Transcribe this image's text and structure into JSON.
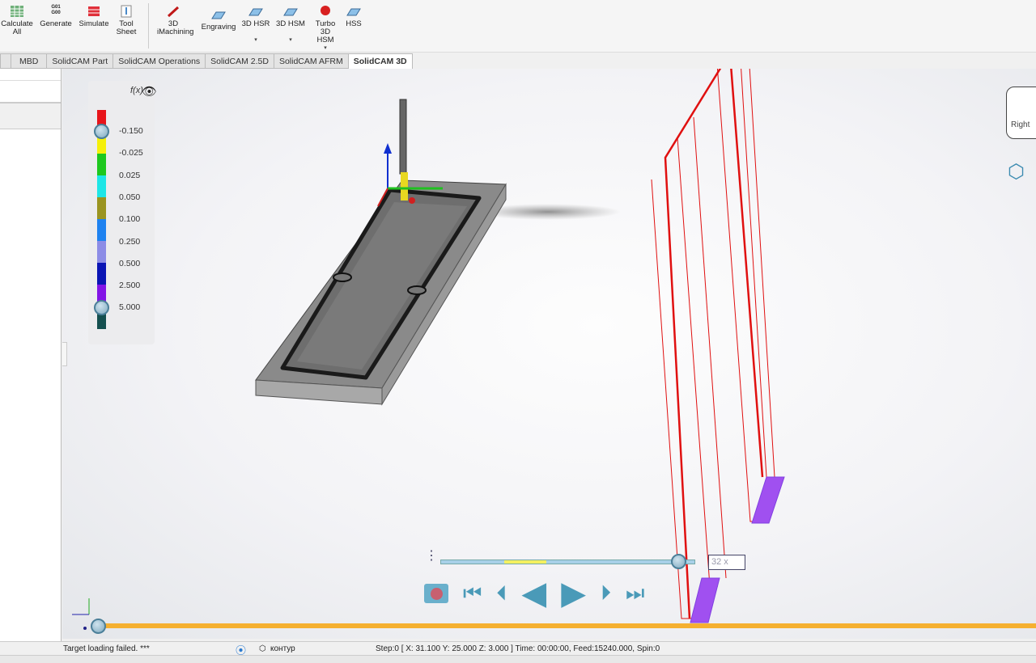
{
  "ribbon": {
    "buttons": [
      {
        "label": "Calculate All",
        "icon": "calculator-grid-icon"
      },
      {
        "label": "Generate",
        "icon": "gcode-icon",
        "glyph": "G01 G00"
      },
      {
        "label": "Simulate",
        "icon": "simulate-stack-icon"
      },
      {
        "label": "Tool Sheet",
        "icon": "tool-sheet-icon"
      },
      {
        "label": "3D iMachining",
        "icon": "imachining-icon"
      },
      {
        "label": "Engraving",
        "icon": "engraving-icon"
      },
      {
        "label": "3D HSR",
        "icon": "hsr-icon"
      },
      {
        "label": "3D HSM",
        "icon": "hsm-icon"
      },
      {
        "label": "Turbo 3D HSM",
        "icon": "turbo-hsm-icon"
      },
      {
        "label": "HSS",
        "icon": "hss-icon"
      }
    ]
  },
  "tabs": [
    "MBD",
    "SolidCAM Part",
    "SolidCAM Operations",
    "SolidCAM 2.5D",
    "SolidCAM AFRM",
    "SolidCAM 3D"
  ],
  "active_tab": "SolidCAM 3D",
  "legend": {
    "labels": [
      "-0.150",
      "-0.025",
      "0.025",
      "0.050",
      "0.100",
      "0.250",
      "0.500",
      "2.500",
      "5.000"
    ],
    "colors": [
      "#e8141a",
      "#f5f00a",
      "#1ec81e",
      "#1ee6e6",
      "#9a9420",
      "#1e82f0",
      "#8c8ce6",
      "#0a14b4",
      "#8214e6",
      "#144f4f"
    ]
  },
  "viewcube": {
    "label": "Right"
  },
  "playback": {
    "speed": "32 x",
    "progress": 0.94
  },
  "colors": {
    "toolpath": "#e01010",
    "timeline": "#f5b030",
    "part": "#6e6e6e"
  },
  "status": {
    "message": "Target loading failed. ***",
    "operation": "контур",
    "step": "Step:0 [ X: 31.100 Y: 25.000 Z: 3.000 ] Time: 00:00:00, Feed:15240.000, Spin:0"
  }
}
